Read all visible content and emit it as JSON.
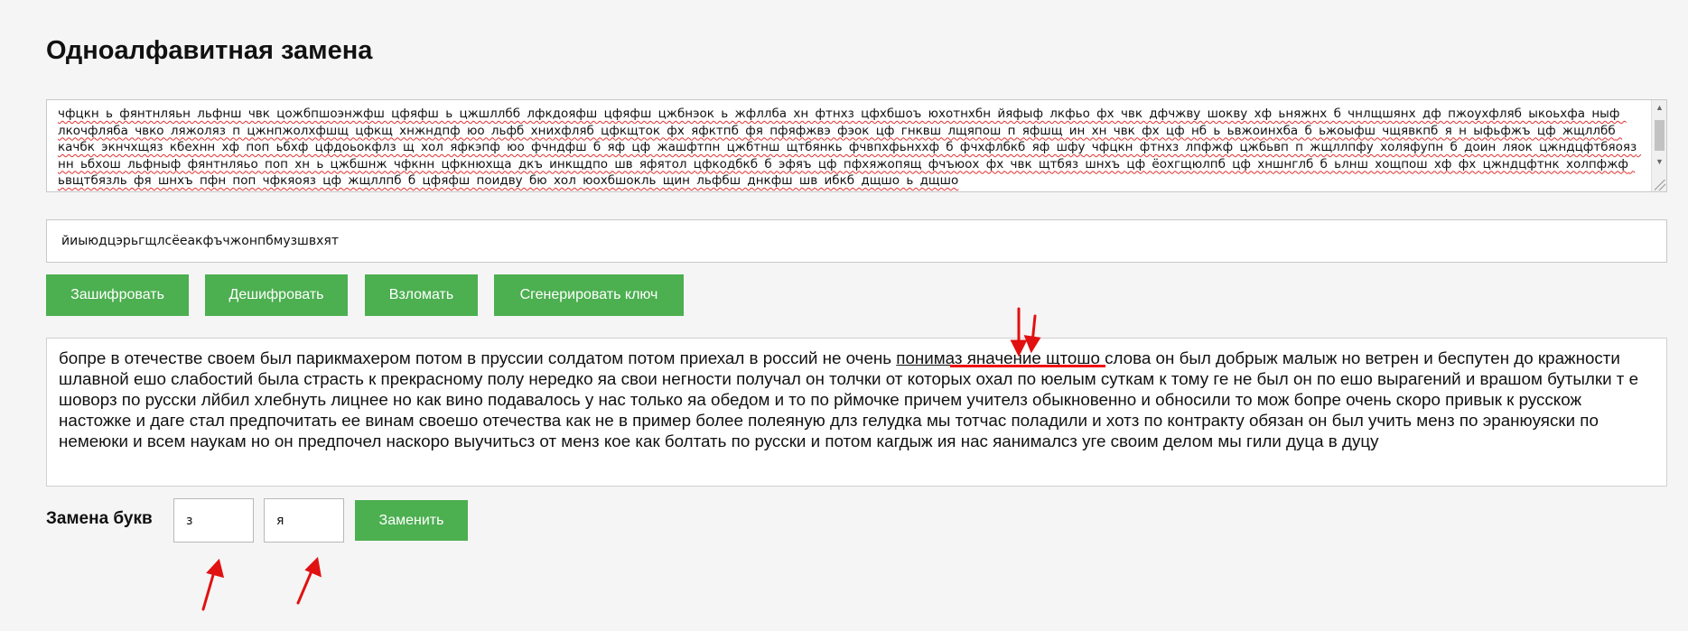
{
  "page": {
    "title": "Одноалфавитная замена"
  },
  "cipher": {
    "text": "чфцкн ь фянтнляьн льфнш чвк цожбпшоэнжфш цфяфш ь цжшллбб лфкдояфш цфяфш цжбнэок ь жфллба хн фтнхз цфхбшоъ юхотнхбн йяфыф лкфьо фх чвк дфчжву шокву хф ьняжнх б чнлщшянх дф пжоухфляб ыкоьхфа ныф лкочфляба чвко ляжоляз п цжнпжолхфшщ цфкщ хнжндпф юо льфб хнихфляб цфкщток фх яфктпб фя пфяфжвэ фэок цф гнквш лщяпош п яфшщ ин хн чвк фх цф нб ь ьвжоинхба б ьжоыфш чщявкпб я н ыфьфжъ цф жщллбб качбк экнчхщяз кбехнн хф поп ьбхф цфдоьокфлз щ хол яфкэпф юо фчндфш б яф цф жашфтпн цжбтнш щтбянкь фчвпхфьнххф б фчхфлбкб яф шфу чфцкн фтнхз лпфжф цжбьвп п жщллпфу холяфупн б доин ляок цжндцфтбяояз нн ьбхош льфныф фянтнляьо поп хн ь цжбшнж чфкнн цфкнюхща дкъ инкщдпо шв яфятол цфкодбкб б эфяъ цф пфхяжопящ фчъюох фх чвк щтбяз шнхъ цф ёохгщюлпб цф хншнглб б ьлнш хощпош хф фх цжндцфтнк холпфжф ьвщтбязль фя шнхъ пфн поп чфкяояз цф жщллпб б цфяфш поидву бю хол юохбшокль щин льфбш днкфш шв ибкб дщшо ь дщшо",
    "scroll_up_icon": "▲",
    "scroll_down_icon": "▼"
  },
  "key": {
    "value": "йиыюдцэрьгщлсёеакфъчжонпбмузшвхят"
  },
  "buttons": {
    "encrypt": "Зашифровать",
    "decrypt": "Дешифровать",
    "crack": "Взломать",
    "generate": "Сгенерировать ключ",
    "replace": "Заменить"
  },
  "result": {
    "before": "бопре в отечестве своем был парикмахером потом в пруссии солдатом потом приехал в россий не очень ",
    "highlight": "понимаз яначение",
    "after": " щтошо слова он был добрыж малыж но ветрен и беспутен до кражности шлавной ешо слабостий была страсть к прекрасному полу нередко яа свои негности получал он толчки от которых охал по юелым суткам к тому ге не был он по ешо вырагений и врашом бутылки т е шоворз по русски лйбил хлебнуть лицнее но как вино подавалось у нас только яа обедом и то по рймочке причем учителз обыкновенно и обносили то мож бопре очень скоро привык к русскож настожке и даге стал предпочитать ее винам своешо отечества как не в пример более полеяную длз гелудка мы тотчас поладили и хотз по контракту обязан он был учить менз по эранюуяски по немеюки и всем наукам но он предпочел наскоро выучитьсз от менз кое как болтать по русски и потом кагдыж ия нас яанималсз уге своим делом мы гили дуца в дуцу"
  },
  "replace": {
    "label": "Замена букв",
    "from_value": "з",
    "to_value": "я"
  },
  "colors": {
    "accent": "#4caf50",
    "annotation": "#e11111",
    "background": "#f5f5f5"
  }
}
